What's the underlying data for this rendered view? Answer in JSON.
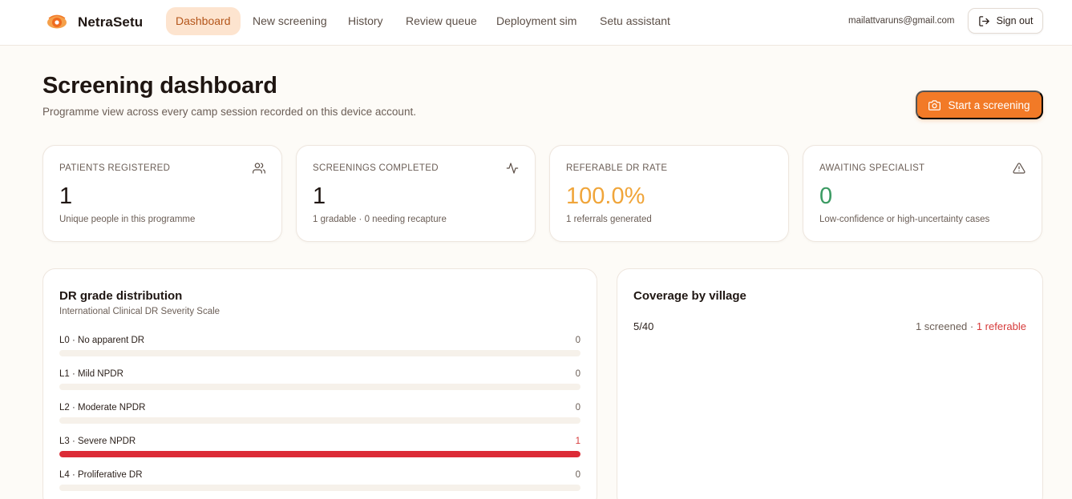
{
  "app": {
    "name": "NetraSetu",
    "accent": "#f27a27"
  },
  "nav": {
    "items": [
      {
        "label": "Dashboard",
        "active": true
      },
      {
        "label": "New screening",
        "active": false
      },
      {
        "label": "History",
        "active": false
      },
      {
        "label": "Review queue",
        "active": false
      },
      {
        "label": "Deployment sim",
        "active": false
      },
      {
        "label": "Setu assistant",
        "active": false
      }
    ]
  },
  "user": {
    "email": "mailattvaruns@gmail.com",
    "signout_label": "Sign out"
  },
  "header": {
    "title": "Screening dashboard",
    "subtitle": "Programme view across every camp session recorded on this device account.",
    "start_button": "Start a screening"
  },
  "stats": [
    {
      "label": "PATIENTS REGISTERED",
      "value": "1",
      "note": "Unique people in this programme",
      "icon": "users-icon"
    },
    {
      "label": "SCREENINGS COMPLETED",
      "value": "1",
      "note": "1 gradable · 0 needing recapture",
      "icon": "activity-icon"
    },
    {
      "label": "REFERABLE DR RATE",
      "value": "100.0%",
      "note": "1 referrals generated",
      "icon": ""
    },
    {
      "label": "AWAITING SPECIALIST",
      "value": "0",
      "note": "Low-confidence or high-uncertainty cases",
      "icon": "alert-triangle-icon"
    }
  ],
  "grade_distribution": {
    "title": "DR grade distribution",
    "subtitle": "International Clinical DR Severity Scale",
    "grades": [
      {
        "label": "L0 · No apparent DR",
        "count": "0",
        "fraction": 0
      },
      {
        "label": "L1 · Mild NPDR",
        "count": "0",
        "fraction": 0
      },
      {
        "label": "L2 · Moderate NPDR",
        "count": "0",
        "fraction": 0
      },
      {
        "label": "L3 · Severe NPDR",
        "count": "1",
        "fraction": 1
      },
      {
        "label": "L4 · Proliferative DR",
        "count": "0",
        "fraction": 0
      }
    ],
    "fill_color": "#dc2b36"
  },
  "coverage": {
    "title": "Coverage by village",
    "villages": [
      {
        "name": "5/40",
        "screened": "1 screened",
        "separator": " · ",
        "referable": "1 referable"
      }
    ]
  }
}
